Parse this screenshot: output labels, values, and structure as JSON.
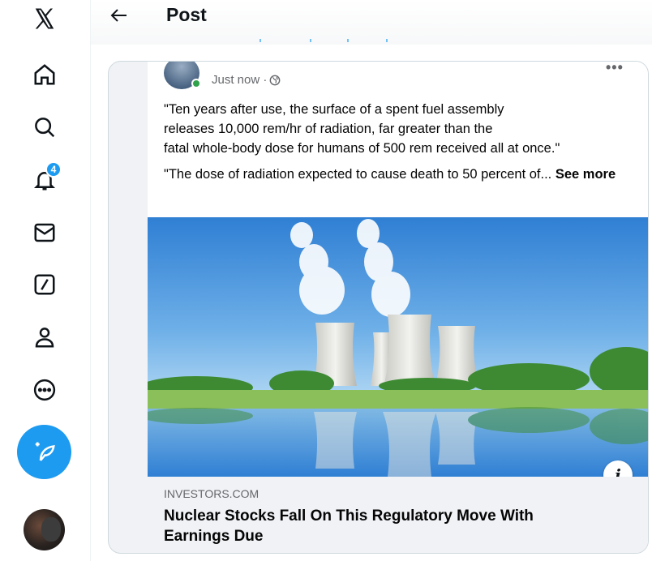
{
  "header": {
    "title": "Post"
  },
  "nav": {
    "notifications_badge": "4"
  },
  "post": {
    "timestamp": "Just now ·",
    "more_label": "•••",
    "paragraph1_line1": "\"Ten years after use, the surface of a spent fuel assembly",
    "paragraph1_line2": "releases 10,000 rem/hr of radiation, far greater than the",
    "paragraph1_line3": "fatal whole-body dose for humans of 500 rem received all at once.\"",
    "paragraph2": "\"The dose of radiation expected to cause death to 50 percent of...",
    "see_more": "See more",
    "info_label": "i"
  },
  "link_preview": {
    "domain": "INVESTORS.COM",
    "headline_line1": "Nuclear Stocks Fall On This Regulatory Move With",
    "headline_line2": "Earnings Due"
  },
  "colors": {
    "accent": "#1d9bf0",
    "online": "#31a24c",
    "muted": "#65676b"
  }
}
